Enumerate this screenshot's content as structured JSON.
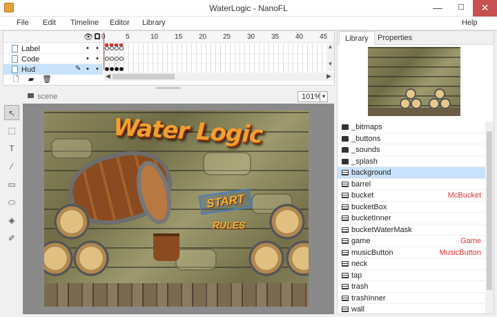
{
  "window": {
    "title": "WaterLogic - NanoFL",
    "minimize": "—",
    "maximize": "☐",
    "close": "✕"
  },
  "menu": {
    "file": "File",
    "edit": "Edit",
    "timeline": "Timeline",
    "editor": "Editor",
    "library": "Library",
    "help": "Help"
  },
  "timeline": {
    "ruler": [
      "0",
      "5",
      "10",
      "15",
      "20",
      "25",
      "30",
      "35",
      "40",
      "45"
    ],
    "layers": [
      {
        "name": "Label"
      },
      {
        "name": "Code"
      },
      {
        "name": "Hud",
        "selected": true
      }
    ],
    "scroll_left": "◀",
    "scroll_right": "▶",
    "scroll_up": "▲",
    "scroll_down": "▼"
  },
  "scene": {
    "label": "scene",
    "zoom": "101%",
    "zoom_arrow": "▾"
  },
  "tools": [
    "select-tool",
    "transform-tool",
    "text-tool",
    "line-tool",
    "rectangle-tool",
    "ellipse-tool",
    "paint-bucket-tool",
    "eyedropper-tool"
  ],
  "stage": {
    "title": "Water Logic",
    "start": "START",
    "rules": "RULES"
  },
  "right_panel": {
    "tabs": [
      "Library",
      "Properties"
    ],
    "active_tab": "Library",
    "items": [
      {
        "name": "_bitmaps",
        "icon": "folder",
        "class": ""
      },
      {
        "name": "_buttons",
        "icon": "folder",
        "class": ""
      },
      {
        "name": "_sounds",
        "icon": "folder",
        "class": ""
      },
      {
        "name": "_splash",
        "icon": "folder",
        "class": ""
      },
      {
        "name": "background",
        "icon": "movieclip",
        "class": "",
        "selected": true
      },
      {
        "name": "barrel",
        "icon": "movieclip",
        "class": ""
      },
      {
        "name": "bucket",
        "icon": "movieclip",
        "class": "McBucket"
      },
      {
        "name": "bucketBox",
        "icon": "movieclip",
        "class": ""
      },
      {
        "name": "bucketInner",
        "icon": "movieclip",
        "class": ""
      },
      {
        "name": "bucketWaterMask",
        "icon": "movieclip",
        "class": ""
      },
      {
        "name": "game",
        "icon": "movieclip",
        "class": "Game"
      },
      {
        "name": "musicButton",
        "icon": "movieclip",
        "class": "MusicButton"
      },
      {
        "name": "neck",
        "icon": "movieclip",
        "class": ""
      },
      {
        "name": "tap",
        "icon": "movieclip",
        "class": ""
      },
      {
        "name": "trash",
        "icon": "movieclip",
        "class": ""
      },
      {
        "name": "trashInner",
        "icon": "movieclip",
        "class": ""
      },
      {
        "name": "wall",
        "icon": "movieclip",
        "class": ""
      }
    ]
  },
  "colors": {
    "selection": "#c9e2fb",
    "class_text": "#e03030",
    "close_button": "#c75050"
  }
}
